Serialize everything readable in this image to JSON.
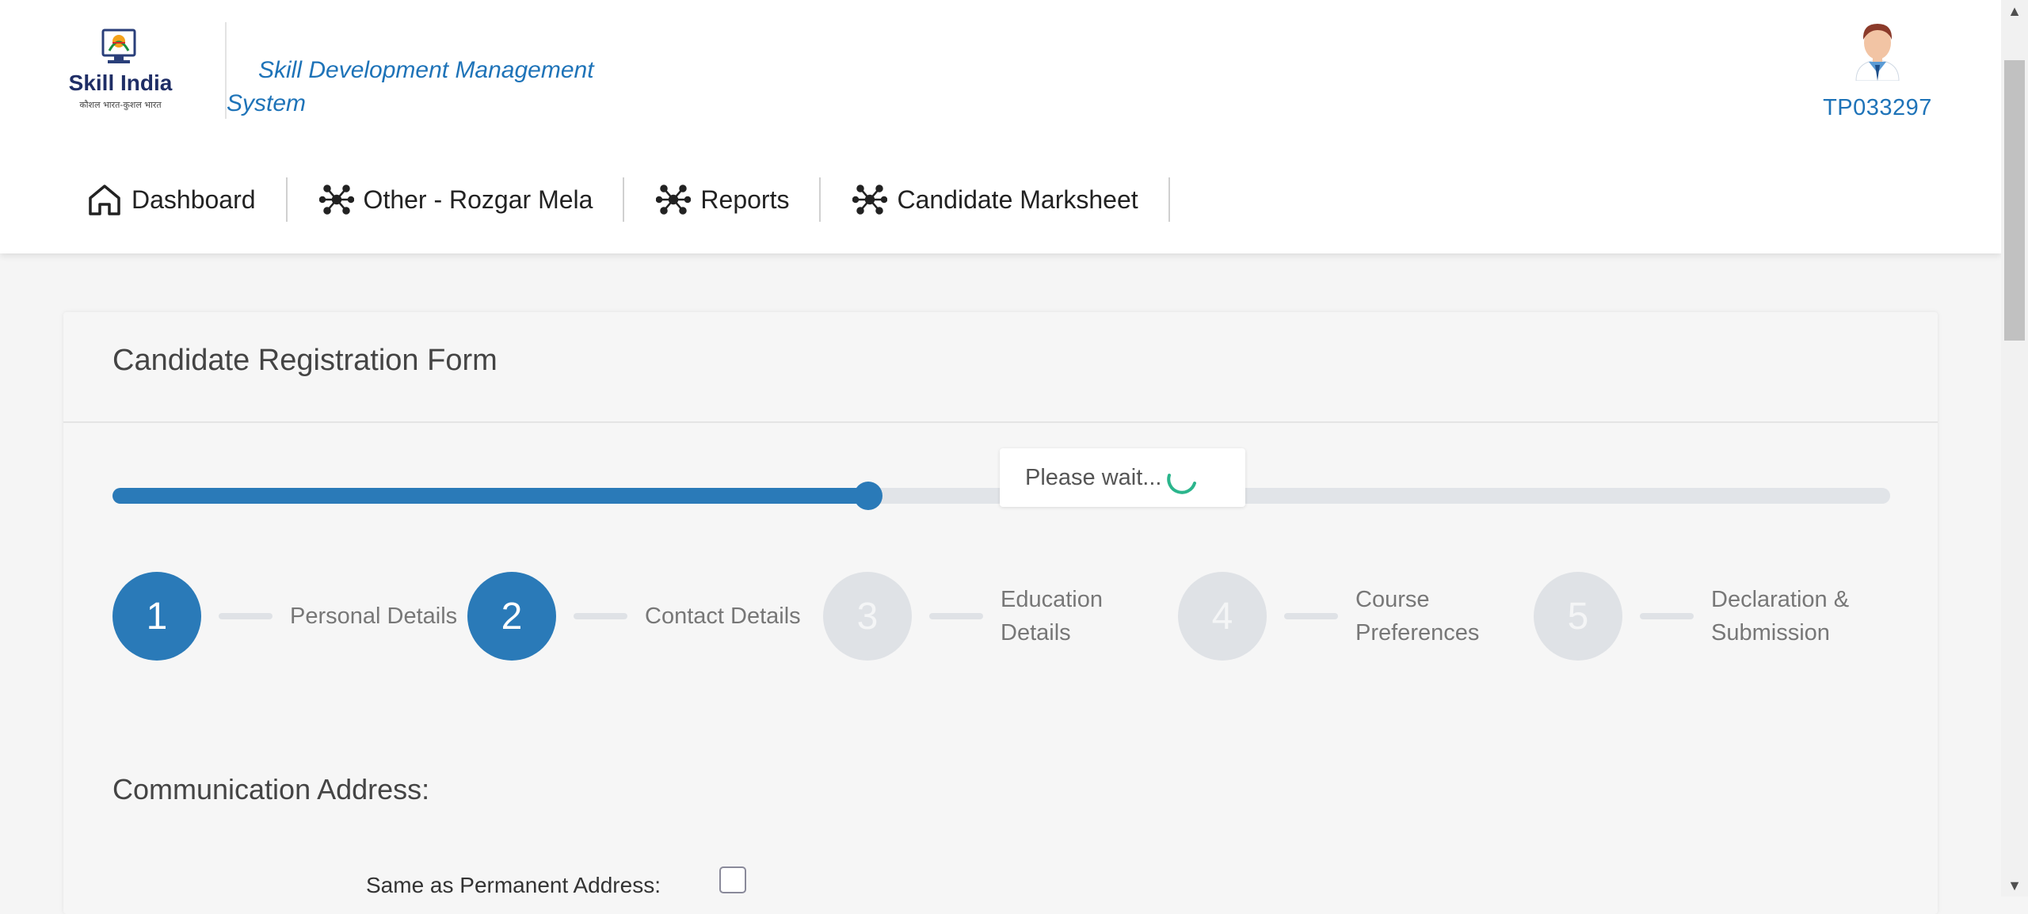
{
  "header": {
    "app_title_line1": "Skill Development Management",
    "app_title_line2": "System",
    "logo_text": "Skill India",
    "logo_tagline": "कौशल भारत-कुशल भारत",
    "user_id": "TP033297"
  },
  "nav": {
    "items": [
      {
        "label": "Dashboard",
        "icon": "home-icon"
      },
      {
        "label": "Other - Rozgar Mela",
        "icon": "network-icon"
      },
      {
        "label": "Reports",
        "icon": "network-icon"
      },
      {
        "label": "Candidate Marksheet",
        "icon": "network-icon"
      }
    ]
  },
  "form": {
    "title": "Candidate Registration Form",
    "progress_percent": 42.5,
    "loading_text": "Please wait...",
    "steps": [
      {
        "number": "1",
        "label": "Personal Details",
        "status": "done"
      },
      {
        "number": "2",
        "label": "Contact Details",
        "status": "done"
      },
      {
        "number": "3",
        "label": "Education\nDetails",
        "status": "pending"
      },
      {
        "number": "4",
        "label": "Course\nPreferences",
        "status": "pending"
      },
      {
        "number": "5",
        "label": "Declaration &\nSubmission",
        "status": "pending"
      }
    ],
    "section_title": "Communication Address:",
    "same_as_permanent_label": "Same as Permanent Address:",
    "same_as_permanent_checked": false
  },
  "colors": {
    "primary": "#2a7ab8",
    "link": "#1e73b8",
    "step_pending": "#dfe2e6",
    "spinner": "#2bb58c"
  }
}
